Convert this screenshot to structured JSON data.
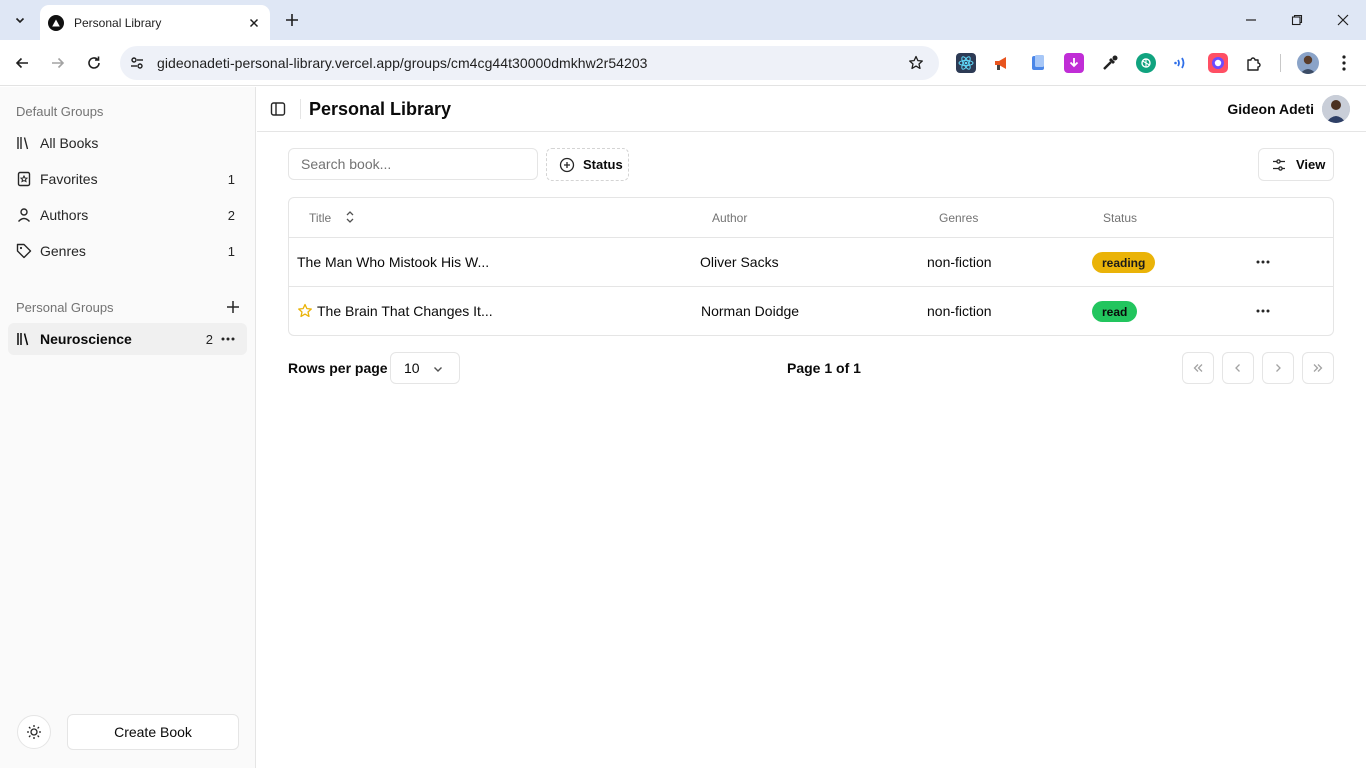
{
  "browser": {
    "tab_title": "Personal Library",
    "url": "gideonadeti-personal-library.vercel.app/groups/cm4cg44t30000dmkhw2r54203"
  },
  "sidebar": {
    "default_groups_label": "Default Groups",
    "items": [
      {
        "label": "All Books",
        "count": "",
        "icon": "library-icon"
      },
      {
        "label": "Favorites",
        "count": "1",
        "icon": "bookmark-icon"
      },
      {
        "label": "Authors",
        "count": "2",
        "icon": "user-icon"
      },
      {
        "label": "Genres",
        "count": "1",
        "icon": "tag-icon"
      }
    ],
    "personal_groups_label": "Personal Groups",
    "personal_items": [
      {
        "label": "Neuroscience",
        "count": "2",
        "icon": "library-icon",
        "active": true
      }
    ],
    "create_label": "Create Book"
  },
  "header": {
    "title": "Personal Library",
    "user_name": "Gideon Adeti"
  },
  "filters": {
    "search_placeholder": "Search book...",
    "status_label": "Status",
    "view_label": "View"
  },
  "table": {
    "columns": [
      "Title",
      "Author",
      "Genres",
      "Status"
    ],
    "rows": [
      {
        "title": "The Man Who Mistook His W...",
        "author": "Oliver Sacks",
        "genres": "non-fiction",
        "status": "reading",
        "favorite": false
      },
      {
        "title": "The Brain That Changes It...",
        "author": "Norman Doidge",
        "genres": "non-fiction",
        "status": "read",
        "favorite": true
      }
    ]
  },
  "pagination": {
    "rows_per_page_label": "Rows per page",
    "rows_per_page_value": "10",
    "page_info": "Page 1 of 1"
  },
  "colors": {
    "reading_badge": "#eab308",
    "read_badge": "#22c55e",
    "favorite_star": "#eab308",
    "chrome_tabbar": "#dfe7f5"
  }
}
